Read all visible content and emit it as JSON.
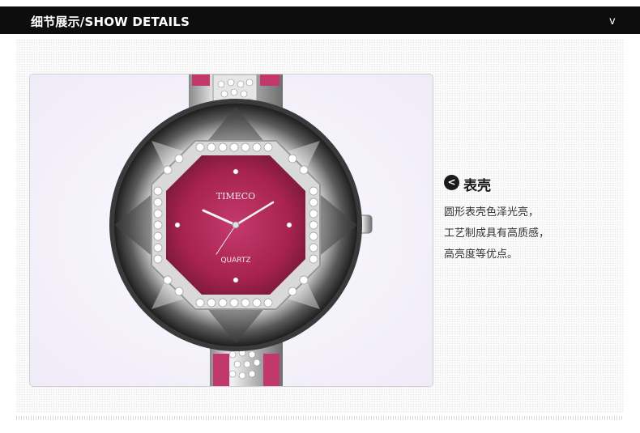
{
  "header": {
    "title": "细节展示/SHOW DETAILS",
    "chevron": "v"
  },
  "watch": {
    "brand": "TIMECO",
    "dial_text": "QUARTZ",
    "dial_color": "#b0285a",
    "strap_color": "#c63a6a"
  },
  "feature": {
    "nav_icon": "chevron-left-icon",
    "nav_glyph": "<",
    "title": "表壳",
    "lines": [
      "圆形表壳色泽光亮，",
      "工艺制成具有高质感，",
      "高亮度等优点。"
    ]
  },
  "colors": {
    "header_bg": "#0d0d0d",
    "header_text": "#ffffff",
    "body_text": "#333333"
  }
}
